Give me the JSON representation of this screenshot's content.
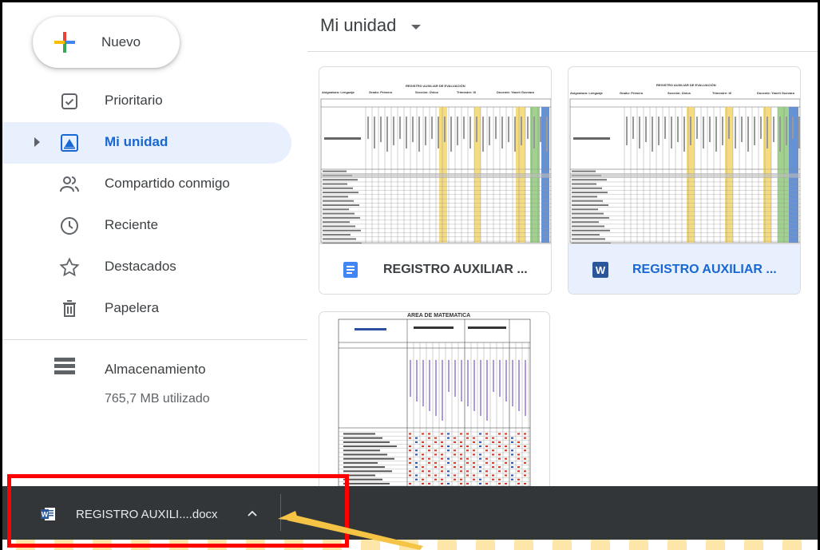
{
  "sidebar": {
    "new_button": "Nuevo",
    "items": [
      {
        "label": "Prioritario",
        "icon": "priority-check-icon"
      },
      {
        "label": "Mi unidad",
        "icon": "my-drive-icon",
        "active": true
      },
      {
        "label": "Compartido conmigo",
        "icon": "shared-people-icon"
      },
      {
        "label": "Reciente",
        "icon": "clock-icon"
      },
      {
        "label": "Destacados",
        "icon": "star-icon"
      },
      {
        "label": "Papelera",
        "icon": "trash-icon"
      }
    ],
    "storage": {
      "label": "Almacenamiento",
      "used": "765,7 MB utilizado",
      "icon": "storage-icon"
    }
  },
  "main": {
    "title": "Mi unidad",
    "files": [
      {
        "name": "REGISTRO AUXILIAR ...",
        "type": "google-doc",
        "icon": "google-docs-icon",
        "color": "#4285f4",
        "thumb_title": "REGISTRO AUXILIAR DE EVALUACIÓN",
        "thumb_header": [
          "Asignatura: Lenguaje",
          "Grado: Primero",
          "Sección: Única",
          "Trimestre: III",
          "Docente: Yaneli Guevara"
        ]
      },
      {
        "name": "REGISTRO AUXILIAR ...",
        "type": "word",
        "icon": "word-icon",
        "color": "#2b579a",
        "selected": true,
        "thumb_title": "REGISTRO AUXILIAR DE EVALUACIÓN",
        "thumb_header": [
          "Asignatura: Lenguaje",
          "Grado: Primero",
          "Sección: Única",
          "Trimestre: III",
          "Docente: Yaneli Guevara"
        ]
      },
      {
        "name": "",
        "type": "sheet",
        "thumb_title": "AREA DE MATEMATICA"
      }
    ]
  },
  "download_bar": {
    "file_name": "REGISTRO AUXILI....docx",
    "icon": "word-file-icon",
    "chevron": "chevron-up-icon"
  },
  "colors": {
    "accent": "#1967d2",
    "active_bg": "#e8f0fe",
    "download_bar": "#323639",
    "highlight": "#ff0000",
    "pointer_arrow": "#f6c445"
  }
}
